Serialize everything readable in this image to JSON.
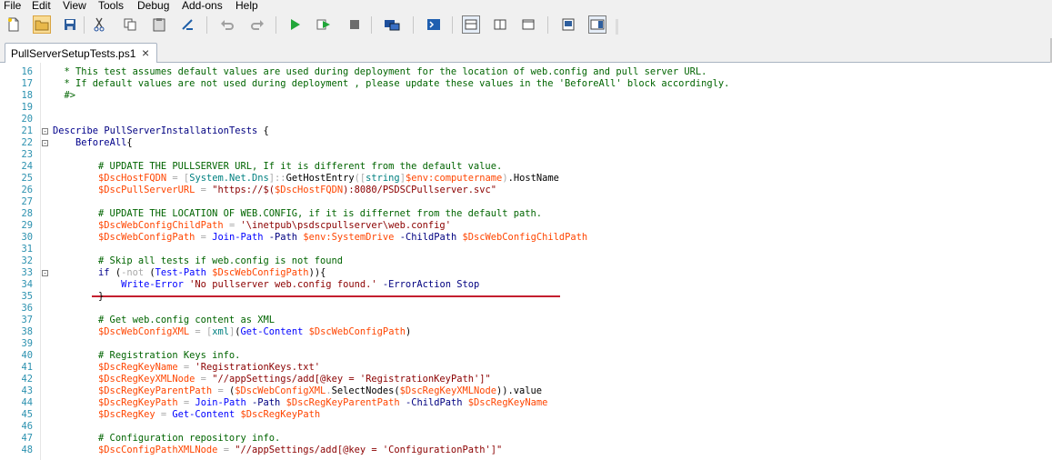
{
  "menu": [
    "File",
    "Edit",
    "View",
    "Tools",
    "Debug",
    "Add-ons",
    "Help"
  ],
  "toolbar_icons": [
    "new-file-icon",
    "open-folder-icon",
    "save-icon",
    "cut-icon",
    "copy-icon",
    "paste-icon",
    "clear-pane-icon",
    "undo-icon",
    "redo-icon",
    "run-script-icon",
    "run-selection-icon",
    "stop-icon",
    "remote-powershell-icon",
    "start-powershell-icon",
    "show-script-pane-top-icon",
    "show-script-pane-right-icon",
    "show-script-pane-maximized-icon",
    "show-command-window-icon",
    "show-command-addon-icon"
  ],
  "tab": {
    "label": "PullServerSetupTests.ps1",
    "close": "×"
  },
  "code_lines": [
    {
      "n": "16",
      "segs": [
        [
          "c",
          "  * This test assumes default values are used during deployment for the location of web.config and pull server URL."
        ]
      ]
    },
    {
      "n": "17",
      "segs": [
        [
          "c",
          "  * If default values are not used during deployment , please update these values in the 'BeforeAll' block accordingly."
        ]
      ]
    },
    {
      "n": "18",
      "segs": [
        [
          "c",
          "  #>"
        ]
      ]
    },
    {
      "n": "19",
      "segs": []
    },
    {
      "n": "20",
      "segs": []
    },
    {
      "n": "21",
      "fold": "-",
      "segs": [
        [
          "k",
          "Describe"
        ],
        [
          "m",
          " "
        ],
        [
          "p",
          "PullServerInstallationTests"
        ],
        [
          "m",
          " {"
        ]
      ]
    },
    {
      "n": "22",
      "fold": "-",
      "segs": [
        [
          "m",
          "    "
        ],
        [
          "k",
          "BeforeAll"
        ],
        [
          "m",
          "{"
        ]
      ]
    },
    {
      "n": "23",
      "segs": []
    },
    {
      "n": "24",
      "segs": [
        [
          "m",
          "        "
        ],
        [
          "c",
          "# UPDATE THE PULLSERVER URL, If it is different from the default value."
        ]
      ]
    },
    {
      "n": "25",
      "segs": [
        [
          "m",
          "        "
        ],
        [
          "v",
          "$DscHostFQDN"
        ],
        [
          "m",
          " "
        ],
        [
          "o",
          "="
        ],
        [
          "m",
          " "
        ],
        [
          "o",
          "["
        ],
        [
          "t",
          "System.Net.Dns"
        ],
        [
          "o",
          "]::"
        ],
        [
          "m",
          "GetHostEntry"
        ],
        [
          "o",
          "(["
        ],
        [
          "t",
          "string"
        ],
        [
          "o",
          "]"
        ],
        [
          "v",
          "$env:computername"
        ],
        [
          "o",
          ")"
        ],
        [
          "m",
          ".HostName"
        ]
      ]
    },
    {
      "n": "26",
      "segs": [
        [
          "m",
          "        "
        ],
        [
          "v",
          "$DscPullServerURL"
        ],
        [
          "m",
          " "
        ],
        [
          "o",
          "="
        ],
        [
          "m",
          " "
        ],
        [
          "s",
          "\"https://$("
        ],
        [
          "v",
          "$DscHostFQDN"
        ],
        [
          "s",
          "):8080/PSDSCPullserver.svc\""
        ]
      ]
    },
    {
      "n": "27",
      "segs": []
    },
    {
      "n": "28",
      "segs": [
        [
          "m",
          "        "
        ],
        [
          "c",
          "# UPDATE THE LOCATION OF WEB.CONFIG, if it is differnet from the default path."
        ]
      ]
    },
    {
      "n": "29",
      "segs": [
        [
          "m",
          "        "
        ],
        [
          "v",
          "$DscWebConfigChildPath"
        ],
        [
          "m",
          " "
        ],
        [
          "o",
          "="
        ],
        [
          "m",
          " "
        ],
        [
          "s",
          "'\\inetpub\\psdscpullserver\\web.config'"
        ]
      ]
    },
    {
      "n": "30",
      "segs": [
        [
          "m",
          "        "
        ],
        [
          "v",
          "$DscWebConfigPath"
        ],
        [
          "m",
          " "
        ],
        [
          "o",
          "="
        ],
        [
          "m",
          " "
        ],
        [
          "cm",
          "Join-Path"
        ],
        [
          "m",
          " "
        ],
        [
          "p",
          "-Path"
        ],
        [
          "m",
          " "
        ],
        [
          "v",
          "$env:SystemDrive"
        ],
        [
          "m",
          " "
        ],
        [
          "p",
          "-ChildPath"
        ],
        [
          "m",
          " "
        ],
        [
          "v",
          "$DscWebConfigChildPath"
        ]
      ]
    },
    {
      "n": "31",
      "segs": []
    },
    {
      "n": "32",
      "segs": [
        [
          "m",
          "        "
        ],
        [
          "c",
          "# Skip all tests if web.config is not found"
        ]
      ]
    },
    {
      "n": "33",
      "fold": "-",
      "segs": [
        [
          "m",
          "        "
        ],
        [
          "k",
          "if"
        ],
        [
          "m",
          " ("
        ],
        [
          "o",
          "-not"
        ],
        [
          "m",
          " ("
        ],
        [
          "cm",
          "Test-Path"
        ],
        [
          "m",
          " "
        ],
        [
          "v",
          "$DscWebConfigPath"
        ],
        [
          "m",
          ")){"
        ]
      ]
    },
    {
      "n": "34",
      "segs": [
        [
          "m",
          "            "
        ],
        [
          "cm",
          "Write-Error"
        ],
        [
          "m",
          " "
        ],
        [
          "s",
          "'No pullserver web.config found.'"
        ],
        [
          "m",
          " "
        ],
        [
          "p",
          "-ErrorAction"
        ],
        [
          "m",
          " "
        ],
        [
          "p",
          "Stop"
        ]
      ]
    },
    {
      "n": "35",
      "segs": [
        [
          "m",
          "        }"
        ]
      ]
    },
    {
      "n": "36",
      "segs": []
    },
    {
      "n": "37",
      "segs": [
        [
          "m",
          "        "
        ],
        [
          "c",
          "# Get web.config content as XML"
        ]
      ]
    },
    {
      "n": "38",
      "segs": [
        [
          "m",
          "        "
        ],
        [
          "v",
          "$DscWebConfigXML"
        ],
        [
          "m",
          " "
        ],
        [
          "o",
          "="
        ],
        [
          "m",
          " "
        ],
        [
          "o",
          "["
        ],
        [
          "t",
          "xml"
        ],
        [
          "o",
          "]"
        ],
        [
          "m",
          "("
        ],
        [
          "cm",
          "Get-Content"
        ],
        [
          "m",
          " "
        ],
        [
          "v",
          "$DscWebConfigPath"
        ],
        [
          "m",
          ")"
        ]
      ]
    },
    {
      "n": "39",
      "segs": []
    },
    {
      "n": "40",
      "segs": [
        [
          "m",
          "        "
        ],
        [
          "c",
          "# Registration Keys info."
        ]
      ]
    },
    {
      "n": "41",
      "segs": [
        [
          "m",
          "        "
        ],
        [
          "v",
          "$DscRegKeyName"
        ],
        [
          "m",
          " "
        ],
        [
          "o",
          "="
        ],
        [
          "m",
          " "
        ],
        [
          "s",
          "'RegistrationKeys.txt'"
        ]
      ]
    },
    {
      "n": "42",
      "segs": [
        [
          "m",
          "        "
        ],
        [
          "v",
          "$DscRegKeyXMLNode"
        ],
        [
          "m",
          " "
        ],
        [
          "o",
          "="
        ],
        [
          "m",
          " "
        ],
        [
          "s",
          "\"//appSettings/add[@key = 'RegistrationKeyPath']\""
        ]
      ]
    },
    {
      "n": "43",
      "segs": [
        [
          "m",
          "        "
        ],
        [
          "v",
          "$DscRegKeyParentPath"
        ],
        [
          "m",
          " "
        ],
        [
          "o",
          "="
        ],
        [
          "m",
          " ("
        ],
        [
          "v",
          "$DscWebConfigXML"
        ],
        [
          "o",
          "."
        ],
        [
          "m",
          "SelectNodes("
        ],
        [
          "v",
          "$DscRegKeyXMLNode"
        ],
        [
          "m",
          ")).value"
        ]
      ]
    },
    {
      "n": "44",
      "segs": [
        [
          "m",
          "        "
        ],
        [
          "v",
          "$DscRegKeyPath"
        ],
        [
          "m",
          " "
        ],
        [
          "o",
          "="
        ],
        [
          "m",
          " "
        ],
        [
          "cm",
          "Join-Path"
        ],
        [
          "m",
          " "
        ],
        [
          "p",
          "-Path"
        ],
        [
          "m",
          " "
        ],
        [
          "v",
          "$DscRegKeyParentPath"
        ],
        [
          "m",
          " "
        ],
        [
          "p",
          "-ChildPath"
        ],
        [
          "m",
          " "
        ],
        [
          "v",
          "$DscRegKeyName"
        ]
      ]
    },
    {
      "n": "45",
      "segs": [
        [
          "m",
          "        "
        ],
        [
          "v",
          "$DscRegKey"
        ],
        [
          "m",
          " "
        ],
        [
          "o",
          "="
        ],
        [
          "m",
          " "
        ],
        [
          "cm",
          "Get-Content"
        ],
        [
          "m",
          " "
        ],
        [
          "v",
          "$DscRegKeyPath"
        ]
      ]
    },
    {
      "n": "46",
      "segs": []
    },
    {
      "n": "47",
      "segs": [
        [
          "m",
          "        "
        ],
        [
          "c",
          "# Configuration repository info."
        ]
      ]
    },
    {
      "n": "48",
      "segs": [
        [
          "m",
          "        "
        ],
        [
          "v",
          "$DscConfigPathXMLNode"
        ],
        [
          "m",
          " "
        ],
        [
          "o",
          "="
        ],
        [
          "m",
          " "
        ],
        [
          "s",
          "\"//appSettings/add[@key = 'ConfigurationPath']\""
        ]
      ]
    }
  ]
}
